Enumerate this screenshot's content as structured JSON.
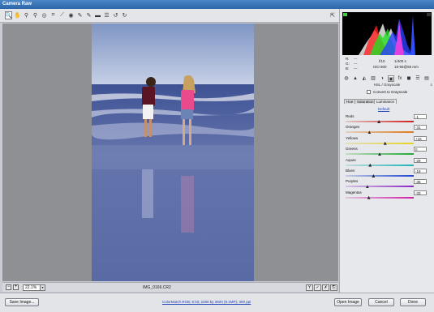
{
  "window": {
    "title": "Camera Raw"
  },
  "toolbar": {
    "tools": [
      {
        "name": "zoom-tool",
        "glyph": "🔍"
      },
      {
        "name": "hand-tool",
        "glyph": "✋"
      },
      {
        "name": "white-balance-tool",
        "glyph": "⚲"
      },
      {
        "name": "color-sampler-tool",
        "glyph": "⚲"
      },
      {
        "name": "targeted-adjustment-tool",
        "glyph": "◎"
      },
      {
        "name": "crop-tool",
        "glyph": "⌗"
      },
      {
        "name": "straighten-tool",
        "glyph": "⟋"
      },
      {
        "name": "red-eye-tool",
        "glyph": "◉"
      },
      {
        "name": "spot-removal-tool",
        "glyph": "✎"
      },
      {
        "name": "adjustment-brush-tool",
        "glyph": "✎"
      },
      {
        "name": "graduated-filter-tool",
        "glyph": "▬"
      },
      {
        "name": "preferences-tool",
        "glyph": "☰"
      },
      {
        "name": "rotate-ccw-tool",
        "glyph": "↺"
      },
      {
        "name": "rotate-cw-tool",
        "glyph": "↻"
      }
    ],
    "fullscreen_glyph": "⇱"
  },
  "statusbar": {
    "zoom_out": "−",
    "zoom_in": "+",
    "zoom_value": "22.1%",
    "filename": "IMG_0166.CR2",
    "icons": [
      "Y",
      "✓",
      "✗",
      "⎘"
    ]
  },
  "info": {
    "r_label": "R:",
    "r_val": "---",
    "g_label": "G:",
    "g_val": "---",
    "b_label": "B:",
    "b_val": "---",
    "aperture": "f/10",
    "shutter": "1/400 s",
    "iso": "ISO 800",
    "lens": "18-55@55 mm"
  },
  "panel_tabs": [
    "◍",
    "▲",
    "◭",
    "▥",
    "◑",
    "▣",
    "fx",
    "◼",
    "☰",
    "▤"
  ],
  "hsl": {
    "title": "HSL / Grayscale",
    "menu": "≡",
    "convert_label": "Convert to Grayscale",
    "subtabs": [
      "Hue",
      "Saturation",
      "Luminance"
    ],
    "active_subtab": 2,
    "default_label": "Default",
    "sliders": [
      {
        "label": "Reds",
        "value": "-1",
        "fraction": 0.49,
        "track": "#e0c8c8,#d21e1e"
      },
      {
        "label": "Oranges",
        "value": "-31",
        "fraction": 0.35,
        "track": "#e2d2c4,#e07818"
      },
      {
        "label": "Yellows",
        "value": "+16",
        "fraction": 0.58,
        "track": "#e2e0c2,#e6d21e"
      },
      {
        "label": "Greens",
        "value": "0",
        "fraction": 0.5,
        "track": "#c8dcc8,#1eaa32"
      },
      {
        "label": "Aquas",
        "value": "-29",
        "fraction": 0.36,
        "track": "#c6dcdc,#1eb4b4"
      },
      {
        "label": "Blues",
        "value": "-18",
        "fraction": 0.41,
        "track": "#c6cce2,#1e46d2"
      },
      {
        "label": "Purples",
        "value": "-36",
        "fraction": 0.32,
        "track": "#d4c6e2,#8c28c8"
      },
      {
        "label": "Magentas",
        "value": "-33",
        "fraction": 0.34,
        "track": "#e2c6dc,#d21eaa"
      }
    ]
  },
  "bottom": {
    "save_label": "Save Image...",
    "workflow_label": "ColorMatch RGB; 8 bit; 2280 by 3920 (9.1MP); 300 ppi",
    "open_label": "Open Image",
    "cancel_label": "Cancel",
    "done_label": "Done"
  },
  "colors": {
    "title_bar": "#2e65a8",
    "link": "#2246b8",
    "sky": "#9fb1d1",
    "water": "#5d6fa8"
  }
}
